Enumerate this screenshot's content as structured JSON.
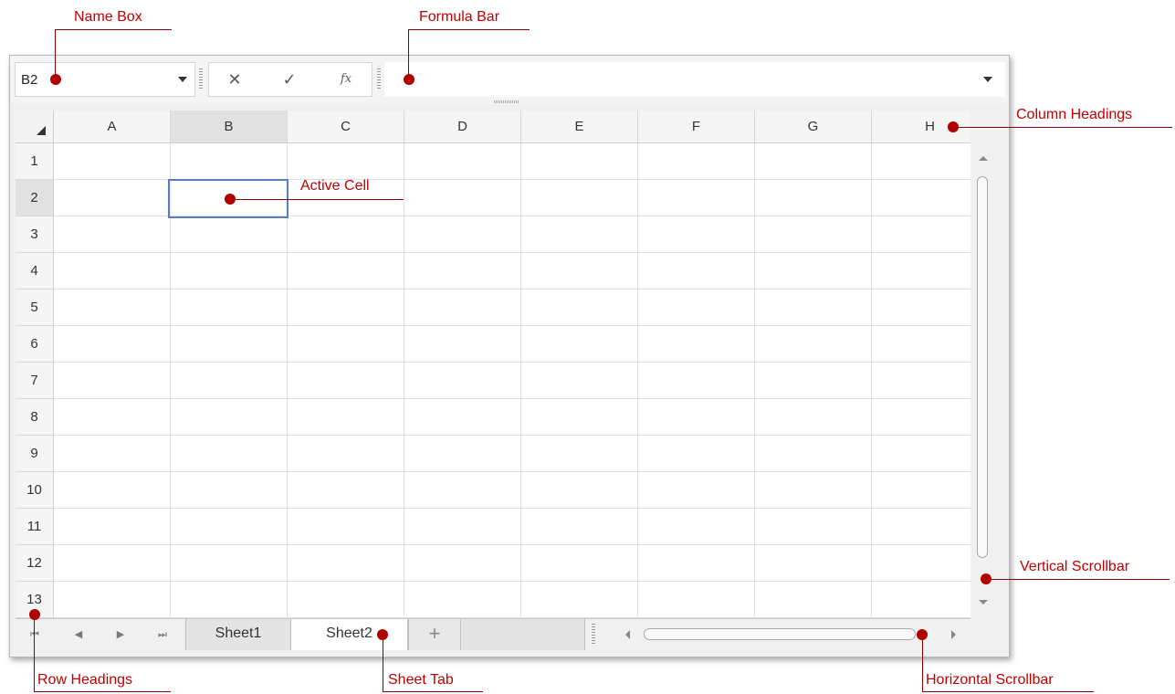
{
  "name_box": {
    "value": "B2"
  },
  "formula_bar": {
    "cancel_icon": "✕",
    "enter_icon": "✓",
    "function_icon": "fx",
    "value": ""
  },
  "columns": [
    "A",
    "B",
    "C",
    "D",
    "E",
    "F",
    "G",
    "H"
  ],
  "rows": [
    "1",
    "2",
    "3",
    "4",
    "5",
    "6",
    "7",
    "8",
    "9",
    "10",
    "11",
    "12",
    "13"
  ],
  "selected": {
    "column": "B",
    "row": "2"
  },
  "sheet_tabs": [
    {
      "label": "Sheet1",
      "active": false
    },
    {
      "label": "Sheet2",
      "active": true
    }
  ],
  "add_sheet": "+",
  "tab_nav": {
    "first": "⏮",
    "prev": "◀",
    "next": "▶",
    "last": "⏭"
  },
  "annotations": {
    "name_box": "Name Box",
    "formula_bar": "Formula Bar",
    "column_headings": "Column Headings",
    "active_cell": "Active Cell",
    "vertical_scrollbar": "Vertical Scrollbar",
    "row_headings": "Row Headings",
    "sheet_tab": "Sheet Tab",
    "horizontal_scrollbar": "Horizontal Scrollbar"
  },
  "colors": {
    "annotation": "#c00000",
    "selection_border": "#5a7fbf"
  }
}
